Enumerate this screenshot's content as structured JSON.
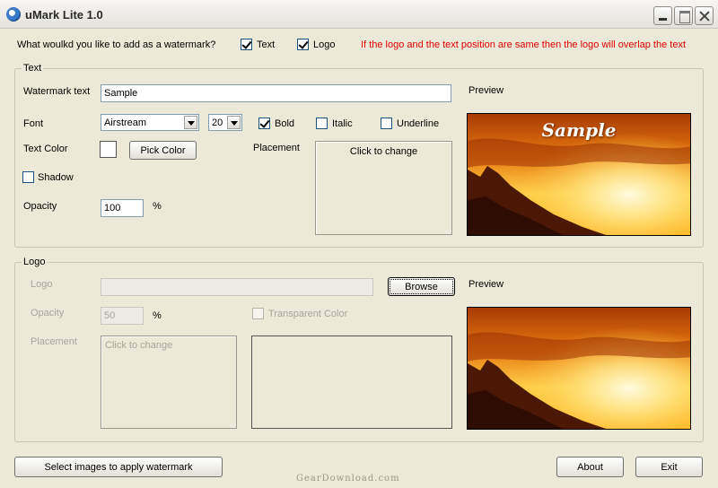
{
  "window": {
    "title": "uMark Lite 1.0"
  },
  "top": {
    "question": "What woulkd you like to add as a watermark?",
    "text_option": "Text",
    "text_checked": true,
    "logo_option": "Logo",
    "logo_checked": true,
    "overlap_note": "If the logo and the text position are same then the logo will overlap the text",
    "note_color": "#e00000"
  },
  "text_group": {
    "label": "Text",
    "watermark_label": "Watermark text",
    "watermark_value": "Sample",
    "font_label": "Font",
    "font_value": "Airstream",
    "size_value": "20",
    "bold_label": "Bold",
    "bold_checked": true,
    "italic_label": "Italic",
    "italic_checked": false,
    "underline_label": "Underline",
    "underline_checked": false,
    "text_color_label": "Text Color",
    "text_color_value": "#ffffff",
    "pick_color_label": "Pick Color",
    "shadow_label": "Shadow",
    "shadow_checked": false,
    "opacity_label": "Opacity",
    "opacity_value": "100",
    "percent": "%",
    "placement_label": "Placement",
    "placement_button": "Click to change",
    "preview_label": "Preview",
    "preview_watermark": "Sample"
  },
  "logo_group": {
    "label": "Logo",
    "logo_label": "Logo",
    "logo_path": "",
    "browse_label": "Browse",
    "opacity_label": "Opacity",
    "opacity_value": "50",
    "percent": "%",
    "transparent_label": "Transparent Color",
    "transparent_checked": false,
    "placement_label": "Placement",
    "placement_button": "Click to change",
    "preview_label": "Preview"
  },
  "footer": {
    "select_images_label": "Select images to apply watermark",
    "about_label": "About",
    "exit_label": "Exit",
    "watermark_logo": "GearDownload.com"
  },
  "icons": {
    "app": "umark-app-icon",
    "minimize": "minimize-icon",
    "maximize": "maximize-icon",
    "close": "close-icon",
    "dropdown": "chevron-down-icon"
  }
}
